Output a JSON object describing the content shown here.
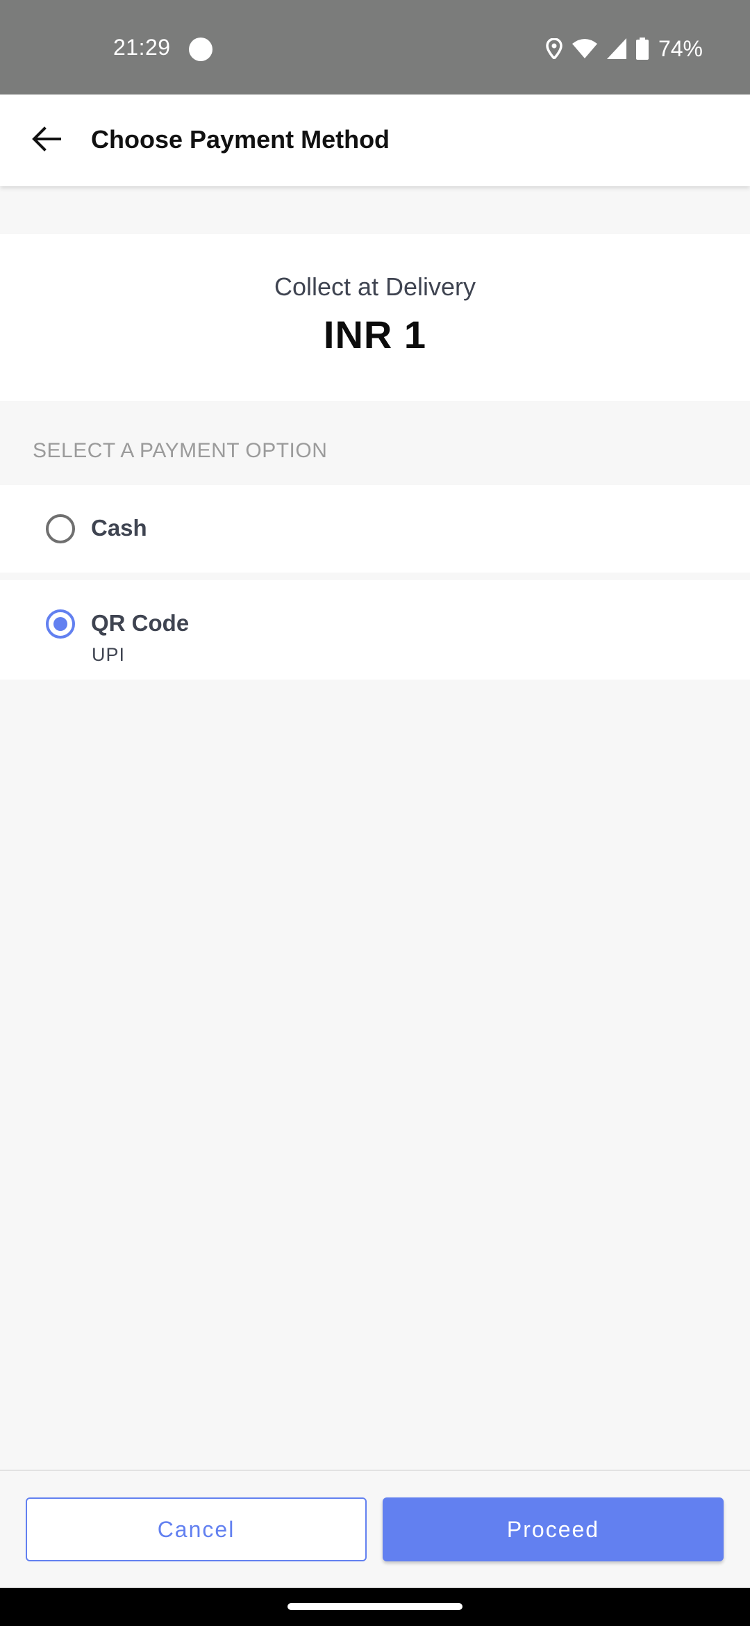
{
  "status_bar": {
    "time": "21:29",
    "battery": "74%",
    "icons": [
      "notification-dot-icon",
      "location-icon",
      "wifi-icon",
      "signal-icon",
      "battery-icon"
    ]
  },
  "app_bar": {
    "title": "Choose Payment Method",
    "back_icon": "arrow-back-icon"
  },
  "amount": {
    "label": "Collect at Delivery",
    "value": "INR 1"
  },
  "section_header": "SELECT A PAYMENT OPTION",
  "options": [
    {
      "label": "Cash",
      "subtitle": "",
      "selected": false
    },
    {
      "label": "QR Code",
      "subtitle": "UPI",
      "selected": true
    }
  ],
  "buttons": {
    "cancel": "Cancel",
    "proceed": "Proceed"
  },
  "colors": {
    "accent": "#6280f0",
    "status_bar": "#7b7c7b",
    "text_dark": "#3f4451"
  }
}
